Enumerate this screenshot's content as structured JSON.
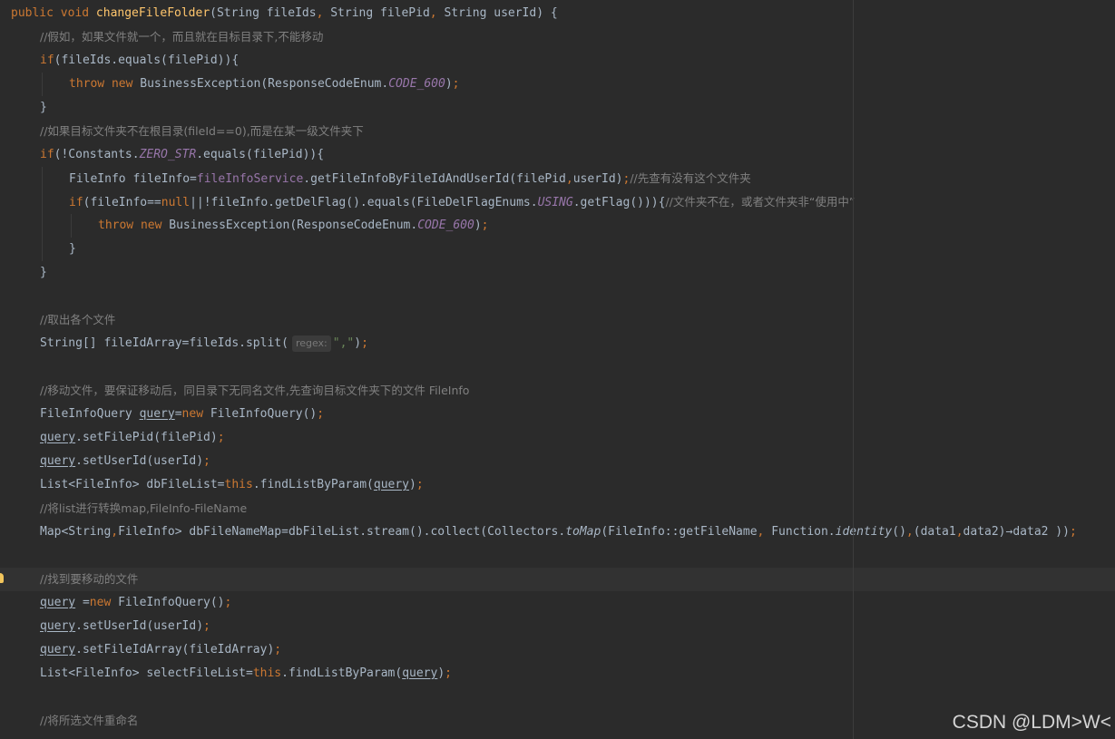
{
  "watermark": "CSDN @LDM>W<",
  "editor": {
    "lines": [
      {
        "indent": 0,
        "current": false,
        "tokens": [
          {
            "t": "public void ",
            "c": "kw"
          },
          {
            "t": "changeFileFolder",
            "c": "fn"
          },
          {
            "t": "(String fileIds",
            "c": "pl"
          },
          {
            "t": ", ",
            "c": "kw"
          },
          {
            "t": "String filePid",
            "c": "pl"
          },
          {
            "t": ", ",
            "c": "kw"
          },
          {
            "t": "String userId) {",
            "c": "pl"
          }
        ]
      },
      {
        "indent": 1,
        "current": false,
        "tokens": [
          {
            "t": "//假如，如果文件就一个，而且就在目标目录下,不能移动",
            "c": "cm"
          }
        ]
      },
      {
        "indent": 1,
        "current": false,
        "tokens": [
          {
            "t": "if",
            "c": "kw"
          },
          {
            "t": "(fileIds.equals(filePid)){",
            "c": "pl"
          }
        ]
      },
      {
        "indent": 2,
        "current": false,
        "tokens": [
          {
            "t": "throw new ",
            "c": "kw"
          },
          {
            "t": "BusinessException(ResponseCodeEnum.",
            "c": "pl"
          },
          {
            "t": "CODE_600",
            "c": "cst"
          },
          {
            "t": ")",
            "c": "pl"
          },
          {
            "t": ";",
            "c": "kw"
          }
        ]
      },
      {
        "indent": 1,
        "current": false,
        "tokens": [
          {
            "t": "}",
            "c": "pl"
          }
        ]
      },
      {
        "indent": 1,
        "current": false,
        "tokens": [
          {
            "t": "//如果目标文件夹不在根目录(fileId==0),而是在某一级文件夹下",
            "c": "cm"
          }
        ]
      },
      {
        "indent": 1,
        "current": false,
        "tokens": [
          {
            "t": "if",
            "c": "kw"
          },
          {
            "t": "(!Constants.",
            "c": "pl"
          },
          {
            "t": "ZERO_STR",
            "c": "cst"
          },
          {
            "t": ".equals(filePid)){",
            "c": "pl"
          }
        ]
      },
      {
        "indent": 2,
        "current": false,
        "tokens": [
          {
            "t": "FileInfo fileInfo=",
            "c": "pl"
          },
          {
            "t": "fileInfoService",
            "c": "fld"
          },
          {
            "t": ".getFileInfoByFileIdAndUserId(filePid",
            "c": "pl"
          },
          {
            "t": ",",
            "c": "kw"
          },
          {
            "t": "userId)",
            "c": "pl"
          },
          {
            "t": ";",
            "c": "kw"
          },
          {
            "t": "//先查有没有这个文件夹",
            "c": "cm"
          }
        ]
      },
      {
        "indent": 2,
        "current": false,
        "tokens": [
          {
            "t": "if",
            "c": "kw"
          },
          {
            "t": "(fileInfo==",
            "c": "pl"
          },
          {
            "t": "null",
            "c": "kw"
          },
          {
            "t": "||!fileInfo.getDelFlag().equals(FileDelFlagEnums.",
            "c": "pl"
          },
          {
            "t": "USING",
            "c": "cst"
          },
          {
            "t": ".getFlag())){",
            "c": "pl"
          },
          {
            "t": "//文件夹不在，或者文件夹非“使用中”",
            "c": "cm"
          }
        ]
      },
      {
        "indent": 3,
        "current": false,
        "tokens": [
          {
            "t": "throw new ",
            "c": "kw"
          },
          {
            "t": "BusinessException(ResponseCodeEnum.",
            "c": "pl"
          },
          {
            "t": "CODE_600",
            "c": "cst"
          },
          {
            "t": ")",
            "c": "pl"
          },
          {
            "t": ";",
            "c": "kw"
          }
        ]
      },
      {
        "indent": 2,
        "current": false,
        "tokens": [
          {
            "t": "}",
            "c": "pl"
          }
        ]
      },
      {
        "indent": 1,
        "current": false,
        "tokens": [
          {
            "t": "}",
            "c": "pl"
          }
        ]
      },
      {
        "indent": 1,
        "current": false,
        "tokens": []
      },
      {
        "indent": 1,
        "current": false,
        "tokens": [
          {
            "t": "//取出各个文件",
            "c": "cm"
          }
        ]
      },
      {
        "indent": 1,
        "current": false,
        "tokens": [
          {
            "t": "String[] fileIdArray=fileIds.split(",
            "c": "pl"
          },
          {
            "t": "regex:",
            "c": "hint"
          },
          {
            "t": "\",\"",
            "c": "str"
          },
          {
            "t": ")",
            "c": "pl"
          },
          {
            "t": ";",
            "c": "kw"
          }
        ]
      },
      {
        "indent": 1,
        "current": false,
        "tokens": []
      },
      {
        "indent": 1,
        "current": false,
        "tokens": [
          {
            "t": "//移动文件，要保证移动后，同目录下无同名文件,先查询目标文件夹下的文件 FileInfo",
            "c": "cm"
          }
        ]
      },
      {
        "indent": 1,
        "current": false,
        "tokens": [
          {
            "t": "FileInfoQuery ",
            "c": "pl"
          },
          {
            "t": "query",
            "c": "und"
          },
          {
            "t": "=",
            "c": "pl"
          },
          {
            "t": "new ",
            "c": "kw"
          },
          {
            "t": "FileInfoQuery()",
            "c": "pl"
          },
          {
            "t": ";",
            "c": "kw"
          }
        ]
      },
      {
        "indent": 1,
        "current": false,
        "tokens": [
          {
            "t": "query",
            "c": "und"
          },
          {
            "t": ".setFilePid(filePid)",
            "c": "pl"
          },
          {
            "t": ";",
            "c": "kw"
          }
        ]
      },
      {
        "indent": 1,
        "current": false,
        "tokens": [
          {
            "t": "query",
            "c": "und"
          },
          {
            "t": ".setUserId(userId)",
            "c": "pl"
          },
          {
            "t": ";",
            "c": "kw"
          }
        ]
      },
      {
        "indent": 1,
        "current": false,
        "tokens": [
          {
            "t": "List<FileInfo> dbFileList=",
            "c": "pl"
          },
          {
            "t": "this",
            "c": "kw"
          },
          {
            "t": ".findListByParam(",
            "c": "pl"
          },
          {
            "t": "query",
            "c": "und"
          },
          {
            "t": ")",
            "c": "pl"
          },
          {
            "t": ";",
            "c": "kw"
          }
        ]
      },
      {
        "indent": 1,
        "current": false,
        "tokens": [
          {
            "t": "//将list进行转换map,FileInfo-FileName",
            "c": "cm"
          }
        ]
      },
      {
        "indent": 1,
        "current": false,
        "tokens": [
          {
            "t": "Map<String",
            "c": "pl"
          },
          {
            "t": ",",
            "c": "kw"
          },
          {
            "t": "FileInfo> dbFileNameMap=dbFileList.stream().collect(Collectors.",
            "c": "pl"
          },
          {
            "t": "toMap",
            "c": "it"
          },
          {
            "t": "(FileInfo::getFileName",
            "c": "pl"
          },
          {
            "t": ", ",
            "c": "kw"
          },
          {
            "t": "Function.",
            "c": "pl"
          },
          {
            "t": "identity",
            "c": "it"
          },
          {
            "t": "()",
            "c": "pl"
          },
          {
            "t": ",",
            "c": "kw"
          },
          {
            "t": "(data1",
            "c": "pl"
          },
          {
            "t": ",",
            "c": "kw"
          },
          {
            "t": "data2)→data2 ))",
            "c": "pl"
          },
          {
            "t": ";",
            "c": "kw"
          }
        ]
      },
      {
        "indent": 1,
        "current": false,
        "tokens": []
      },
      {
        "indent": 1,
        "current": true,
        "tokens": [
          {
            "t": "//找到要移动的文件",
            "c": "cm"
          }
        ]
      },
      {
        "indent": 1,
        "current": false,
        "tokens": [
          {
            "t": "query",
            "c": "und"
          },
          {
            "t": " =",
            "c": "pl"
          },
          {
            "t": "new ",
            "c": "kw"
          },
          {
            "t": "FileInfoQuery()",
            "c": "pl"
          },
          {
            "t": ";",
            "c": "kw"
          }
        ]
      },
      {
        "indent": 1,
        "current": false,
        "tokens": [
          {
            "t": "query",
            "c": "und"
          },
          {
            "t": ".setUserId(userId)",
            "c": "pl"
          },
          {
            "t": ";",
            "c": "kw"
          }
        ]
      },
      {
        "indent": 1,
        "current": false,
        "tokens": [
          {
            "t": "query",
            "c": "und"
          },
          {
            "t": ".setFileIdArray(fileIdArray)",
            "c": "pl"
          },
          {
            "t": ";",
            "c": "kw"
          }
        ]
      },
      {
        "indent": 1,
        "current": false,
        "tokens": [
          {
            "t": "List<FileInfo> selectFileList=",
            "c": "pl"
          },
          {
            "t": "this",
            "c": "kw"
          },
          {
            "t": ".findListByParam(",
            "c": "pl"
          },
          {
            "t": "query",
            "c": "und"
          },
          {
            "t": ")",
            "c": "pl"
          },
          {
            "t": ";",
            "c": "kw"
          }
        ]
      },
      {
        "indent": 1,
        "current": false,
        "tokens": []
      },
      {
        "indent": 1,
        "current": false,
        "tokens": [
          {
            "t": "//将所选文件重命名",
            "c": "cm"
          }
        ]
      }
    ]
  }
}
